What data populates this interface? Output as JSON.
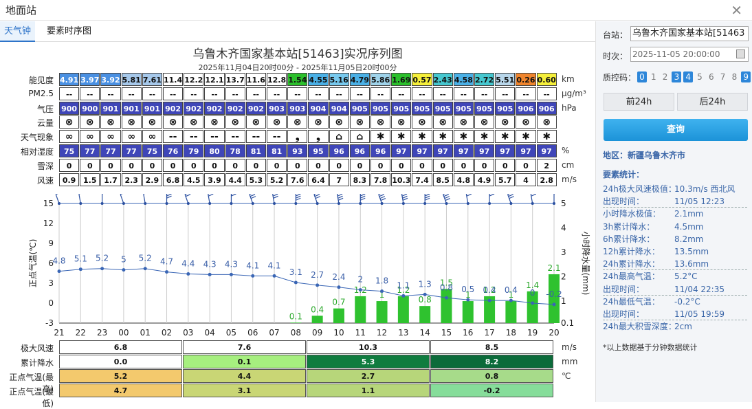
{
  "window": {
    "title": "地面站"
  },
  "tabs": [
    {
      "label": "天气钟"
    },
    {
      "label": "要素时序图"
    }
  ],
  "chart_title": "乌鲁木齐国家基本站[51463]实况序列图",
  "chart_subtitle": "2025年11月04日20时00分 - 2025年11月05日20时00分",
  "rows": [
    {
      "label": "能见度",
      "unit": "km",
      "values": [
        "4.91",
        "3.97",
        "3.92",
        "5.81",
        "7.61",
        "11.42",
        "12.27",
        "12.11",
        "13.76",
        "11.63",
        "12.80",
        "1.54",
        "4.55",
        "5.16",
        "4.79",
        "5.86",
        "1.69",
        "0.57",
        "2.43",
        "4.58",
        "2.72",
        "5.51",
        "0.26",
        "0.60"
      ],
      "colors": [
        "#4a90e2",
        "#4a90e2",
        "#4a90e2",
        "#a6c8ea",
        "#a6c8ea",
        "#ffffff",
        "#ffffff",
        "#ffffff",
        "#ffffff",
        "#ffffff",
        "#ffffff",
        "#2cc02c",
        "#4ab0e6",
        "#77c9ee",
        "#4ab0e6",
        "#9fd3ea",
        "#2cc02c",
        "#f5ef3a",
        "#46c7cf",
        "#4ab0e6",
        "#46c7cf",
        "#b8d6ea",
        "#f0852d",
        "#f5ef3a"
      ]
    },
    {
      "label": "PM2.5",
      "unit": "μg/m³",
      "values": [
        "--",
        "--",
        "--",
        "--",
        "--",
        "--",
        "--",
        "--",
        "--",
        "--",
        "--",
        "--",
        "--",
        "--",
        "--",
        "--",
        "--",
        "--",
        "--",
        "--",
        "--",
        "--",
        "--",
        "--"
      ]
    },
    {
      "label": "气压",
      "unit": "hPa",
      "values": [
        "900",
        "900",
        "901",
        "901",
        "901",
        "902",
        "902",
        "902",
        "902",
        "902",
        "903",
        "903",
        "904",
        "904",
        "905",
        "905",
        "905",
        "905",
        "905",
        "905",
        "905",
        "905",
        "906",
        "906"
      ],
      "bg": "#3f46b8"
    },
    {
      "label": "云量",
      "unit": "",
      "values": [
        "⊗",
        "⊗",
        "⊗",
        "⊗",
        "⊗",
        "⊗",
        "⊗",
        "⊗",
        "⊗",
        "⊗",
        "⊗",
        "⊗",
        "⊗",
        "⊗",
        "⊗",
        "⊗",
        "⊗",
        "⊗",
        "⊗",
        "⊗",
        "⊗",
        "⊗",
        "⊗",
        "⊗"
      ]
    },
    {
      "label": "天气现象",
      "unit": "",
      "values": [
        "∞",
        "∞",
        "∞",
        "∞",
        "∞",
        "--",
        "--",
        "--",
        "--",
        "--",
        "--",
        "❟",
        "❟",
        "⌂",
        "⌂",
        "✱",
        "✱",
        "✱",
        "✱",
        "✱",
        "✱",
        "✱",
        "✱",
        "✱"
      ]
    },
    {
      "label": "相对湿度",
      "unit": "%",
      "values": [
        "75",
        "77",
        "77",
        "77",
        "75",
        "76",
        "79",
        "80",
        "78",
        "81",
        "81",
        "93",
        "95",
        "96",
        "96",
        "96",
        "97",
        "97",
        "97",
        "97",
        "97",
        "97",
        "97",
        "97"
      ],
      "bg": "#3f46b8"
    },
    {
      "label": "雪深",
      "unit": "cm",
      "values": [
        "0",
        "0",
        "0",
        "0",
        "0",
        "0",
        "0",
        "0",
        "0",
        "0",
        "0",
        "0",
        "0",
        "0",
        "0",
        "0",
        "0",
        "0",
        "0",
        "0",
        "0",
        "0",
        "0",
        "2"
      ]
    },
    {
      "label": "风速",
      "unit": "m/s",
      "values": [
        "0.9",
        "1.5",
        "1.7",
        "2.3",
        "2.9",
        "6.8",
        "4.5",
        "3.9",
        "4.4",
        "5.3",
        "5.2",
        "7.6",
        "6.4",
        "7",
        "8.3",
        "7.8",
        "10.3",
        "7.4",
        "8.5",
        "4.8",
        "4.9",
        "5.7",
        "4",
        "2.8"
      ]
    }
  ],
  "chart_data": {
    "type": "line",
    "categories": [
      "21",
      "22",
      "23",
      "00",
      "01",
      "02",
      "03",
      "04",
      "05",
      "06",
      "07",
      "08",
      "09",
      "10",
      "11",
      "12",
      "13",
      "14",
      "15",
      "16",
      "17",
      "18",
      "19",
      "20"
    ],
    "series": [
      {
        "name": "正点气温(℃)",
        "type": "line",
        "axis": "left",
        "values": [
          4.8,
          5.1,
          5.2,
          5,
          5.2,
          4.7,
          4.4,
          4.3,
          4.3,
          4.1,
          4.1,
          3.1,
          2.7,
          2.4,
          2,
          1.8,
          1.1,
          1.3,
          0.8,
          0.5,
          0.4,
          0.4,
          0,
          -0.2
        ]
      },
      {
        "name": "小时降水量(mm)",
        "type": "bar",
        "axis": "right",
        "values": [
          null,
          null,
          null,
          null,
          null,
          null,
          null,
          null,
          null,
          null,
          null,
          0.1,
          0.4,
          0.7,
          1.2,
          1,
          1.2,
          0.8,
          1.5,
          1,
          1.2,
          1,
          1.4,
          2.1
        ]
      }
    ],
    "wind_barbs": [
      0.9,
      1.5,
      1.7,
      2.3,
      2.9,
      6.8,
      4.5,
      3.9,
      4.4,
      5.3,
      5.2,
      7.6,
      6.4,
      7,
      8.3,
      7.8,
      10.3,
      7.4,
      8.5,
      4.8,
      4.9,
      5.7,
      4,
      2.8
    ],
    "ylabel": "正点气温(℃)",
    "y2label": "小时降水量(mm)",
    "yticks": [
      "15",
      "12",
      "9",
      "6",
      "3",
      "0",
      "-3"
    ],
    "ylim": [
      -3,
      15
    ],
    "y2ticks": [
      "5",
      "4",
      "3",
      "2",
      "1",
      "0.1"
    ],
    "y2lim": [
      0.1,
      5
    ]
  },
  "bottom": {
    "rows": [
      {
        "label": "极大风速",
        "unit": "m/s",
        "values": [
          "6.8",
          "7.6",
          "10.3",
          "8.5"
        ],
        "colors": [
          "#ffffff",
          "#ffffff",
          "#ffffff",
          "#ffffff"
        ]
      },
      {
        "label": "累计降水",
        "unit": "mm",
        "values": [
          "0.0",
          "0.1",
          "5.3",
          "8.2"
        ],
        "colors": [
          "#ffffff",
          "#a6ef7f",
          "#0f7c3f",
          "#0b6b3a"
        ]
      },
      {
        "label": "正点气温(最高)",
        "unit": "℃",
        "values": [
          "5.2",
          "4.4",
          "2.7",
          "0.8"
        ],
        "colors": [
          "#f3c96d",
          "#c9d675",
          "#b7d67a",
          "#a7db8a"
        ]
      },
      {
        "label": "正点气温(最低)",
        "unit": "",
        "values": [
          "4.7",
          "3.1",
          "1.1",
          "-0.2"
        ],
        "colors": [
          "#f3c96d",
          "#c9d675",
          "#b7d67a",
          "#86dd9a"
        ]
      }
    ]
  },
  "sidebar": {
    "station_label": "台站：",
    "station_value": "乌鲁木齐国家基本站[51463",
    "time_label": "时次：",
    "time_value": "2025-11-05 20:00:00",
    "qc_label": "质控码：",
    "qc_codes": [
      "0",
      "1",
      "2",
      "3",
      "4",
      "5",
      "6",
      "7",
      "8",
      "9"
    ],
    "prev_btn": "前24h",
    "next_btn": "后24h",
    "query_btn": "查询",
    "region": "地区：新疆乌鲁木齐市",
    "stats_title": "要素统计：",
    "stats": [
      {
        "k": "24h极大风速极值：",
        "v": "10.3m/s 西北风"
      },
      {
        "k": "出现时间：",
        "v": "11/05 12:23"
      },
      {
        "k": "小时降水极值：",
        "v": "2.1mm"
      },
      {
        "k": "3h累计降水：",
        "v": "4.5mm"
      },
      {
        "k": "6h累计降水：",
        "v": "8.2mm"
      },
      {
        "k": "12h累计降水：",
        "v": "13.5mm"
      },
      {
        "k": "24h累计降水：",
        "v": "13.6mm"
      },
      {
        "k": "24h最高气温：",
        "v": "5.2°C"
      },
      {
        "k": "出现时间：",
        "v": "11/04 22:35"
      },
      {
        "k": "24h最低气温：",
        "v": "-0.2°C"
      },
      {
        "k": "出现时间：",
        "v": "11/05 19:59"
      },
      {
        "k": "24h最大积雪深度：",
        "v": "2cm"
      }
    ],
    "footnote": "*以上数据基于分钟数据统计"
  },
  "colors": {
    "accent": "#2e74c9",
    "line": "#3a66b5",
    "bar": "#2fc22f"
  }
}
